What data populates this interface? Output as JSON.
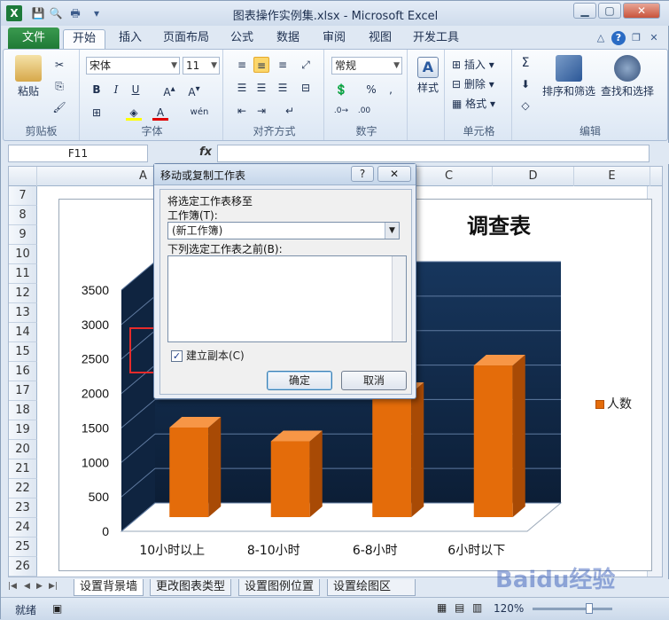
{
  "window": {
    "title": "图表操作实例集.xlsx - Microsoft Excel",
    "logo": "X",
    "controls": {
      "min": "▁",
      "max": "▢",
      "close": "✕"
    }
  },
  "tabs": {
    "file": "文件",
    "items": [
      "开始",
      "插入",
      "页面布局",
      "公式",
      "数据",
      "审阅",
      "视图",
      "开发工具"
    ],
    "active": "开始"
  },
  "ribbon": {
    "clipboard": {
      "label": "剪贴板",
      "paste": "粘贴"
    },
    "font": {
      "label": "字体",
      "name": "宋体",
      "size": "11",
      "bold": "B",
      "italic": "I",
      "underline": "U",
      "font_color": "A",
      "phonetic": "wén"
    },
    "alignment": {
      "label": "对齐方式"
    },
    "number": {
      "label": "数字",
      "format": "常规",
      "percent": "%",
      "comma": ","
    },
    "styles": {
      "label": "样式",
      "button": "样式"
    },
    "cells": {
      "label": "单元格",
      "insert": "插入",
      "delete": "删除",
      "format": "格式"
    },
    "editing": {
      "label": "编辑",
      "sort": "排序和筛选",
      "find": "查找和选择",
      "sum": "Σ"
    }
  },
  "formula_bar": {
    "name_box": "F11",
    "fx": "fx",
    "content": ""
  },
  "sheet": {
    "columns": [
      "A",
      "C",
      "D",
      "E"
    ],
    "rows": [
      "7",
      "8",
      "9",
      "10",
      "11",
      "12",
      "13",
      "14",
      "15",
      "16",
      "17",
      "18",
      "19",
      "20",
      "21",
      "22",
      "23",
      "24",
      "25",
      "26"
    ]
  },
  "chart_data": {
    "type": "bar",
    "title": "调查表",
    "categories": [
      "10小时以上",
      "8-10小时",
      "6-8小时",
      "6小时以下"
    ],
    "series": [
      {
        "name": "人数",
        "values": [
          1300,
          1100,
          1800,
          2200
        ]
      }
    ],
    "yticks": [
      "0",
      "500",
      "1000",
      "1500",
      "2000",
      "2500",
      "3000",
      "3500"
    ],
    "ylim": [
      0,
      3500
    ],
    "colors": {
      "bar": "#e46c0a",
      "bar_dark": "#a84a05",
      "bar_light": "#f79646",
      "wall": "#17365d"
    }
  },
  "dialog": {
    "title": "移动或复制工作表",
    "help": "?",
    "close": "✕",
    "move_to_label": "将选定工作表移至",
    "workbook_label": "工作簿(T):",
    "workbook_value": "(新工作簿)",
    "before_label": "下列选定工作表之前(B):",
    "copy_checkbox": "建立副本(C)",
    "copy_checked": true,
    "ok": "确定",
    "cancel": "取消"
  },
  "sheet_tabs": [
    "设置背景墙",
    "更改图表类型",
    "设置图例位置",
    "设置绘图区"
  ],
  "status": {
    "ready": "就绪",
    "zoom": "120%"
  },
  "watermark": "Baidu经验"
}
